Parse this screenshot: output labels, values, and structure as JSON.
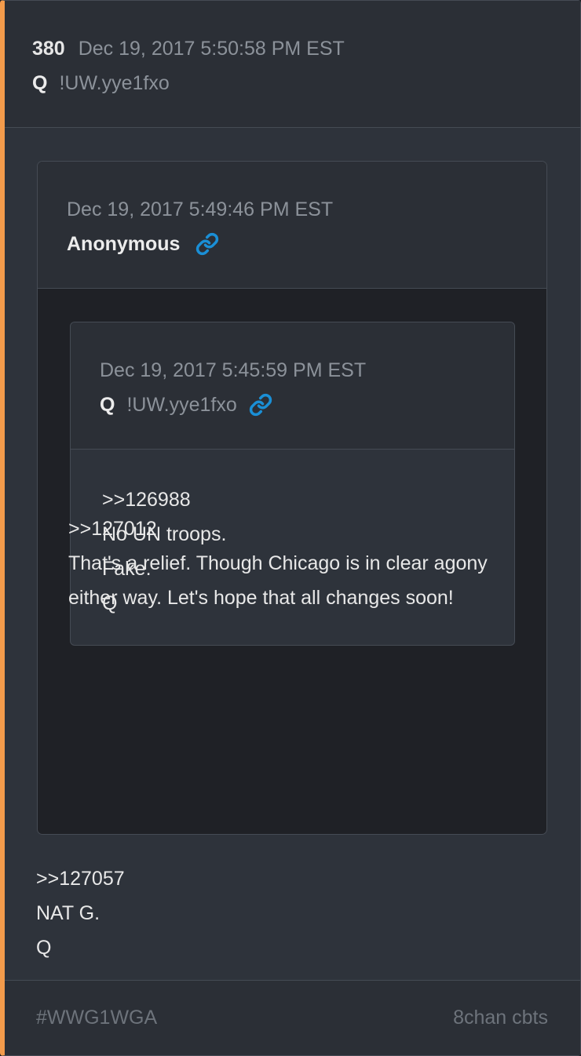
{
  "post": {
    "number": "380",
    "date": "Dec 19, 2017 5:50:58 PM EST",
    "author": "Q",
    "tripcode": "!UW.yye1fxo",
    "body_lines": [
      ">>127057",
      "NAT G.",
      "Q"
    ]
  },
  "quoted_post": {
    "date": "Dec 19, 2017 5:49:46 PM EST",
    "author": "Anonymous",
    "link_icon": "link-icon",
    "body_lines": [
      ">>127012",
      "That's a relief. Though Chicago is in clear agony either way. Let's hope that all changes soon!"
    ]
  },
  "nested_quote": {
    "date": "Dec 19, 2017 5:45:59 PM EST",
    "author": "Q",
    "tripcode": "!UW.yye1fxo",
    "link_icon": "link-icon",
    "body_lines": [
      ">>126988",
      "No UN troops.",
      "Fake.",
      "Q"
    ]
  },
  "footer": {
    "hashtag": "#WWG1WGA",
    "source": "8chan cbts"
  },
  "colors": {
    "accent": "#f39b4b",
    "link": "#1a8fd6"
  }
}
